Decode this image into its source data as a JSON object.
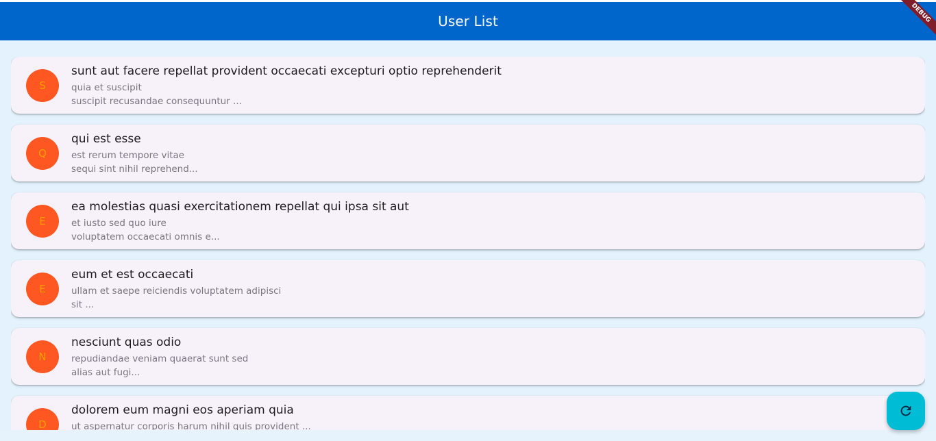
{
  "app": {
    "title": "User List",
    "debug_label": "DEBUG"
  },
  "colors": {
    "appbar": "#0066cc",
    "background": "#e3f2fd",
    "card": "#f7f2fa",
    "avatar": "#ff5722",
    "avatar_letter": "#ffa000",
    "fab": "#00bcd4"
  },
  "posts": [
    {
      "initial": "S",
      "title": "sunt aut facere repellat provident occaecati excepturi optio reprehenderit",
      "line1": "quia et suscipit",
      "line2": "suscipit recusandae consequuntur ..."
    },
    {
      "initial": "Q",
      "title": "qui est esse",
      "line1": "est rerum tempore vitae",
      "line2": "sequi sint nihil reprehend..."
    },
    {
      "initial": "E",
      "title": "ea molestias quasi exercitationem repellat qui ipsa sit aut",
      "line1": "et iusto sed quo iure",
      "line2": "voluptatem occaecati omnis e..."
    },
    {
      "initial": "E",
      "title": "eum et est occaecati",
      "line1": "ullam et saepe reiciendis voluptatem adipisci",
      "line2": "sit ..."
    },
    {
      "initial": "N",
      "title": "nesciunt quas odio",
      "line1": "repudiandae veniam quaerat sunt sed",
      "line2": "alias aut fugi..."
    },
    {
      "initial": "D",
      "title": "dolorem eum magni eos aperiam quia",
      "line1": "ut aspernatur corporis harum nihil quis provident ...",
      "line2": ""
    }
  ],
  "fab": {
    "icon": "refresh-icon"
  }
}
